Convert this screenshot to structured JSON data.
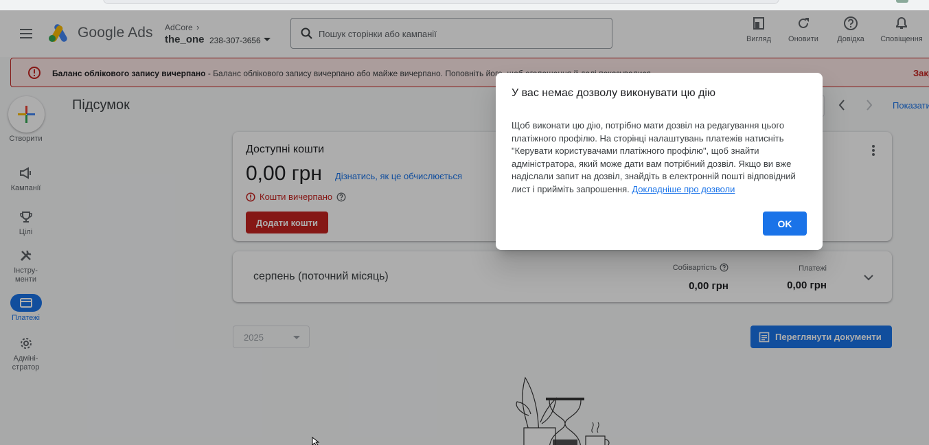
{
  "header": {
    "brand": "Google Ads",
    "account_parent": "AdCore",
    "account_name": "the_one",
    "account_id": "238-307-3656",
    "search_placeholder": "Пошук сторінки або кампанії",
    "tools": [
      {
        "label": "Вигляд",
        "icon": "appearance-icon"
      },
      {
        "label": "Оновити",
        "icon": "refresh-icon"
      },
      {
        "label": "Довідка",
        "icon": "help-icon"
      },
      {
        "label": "Сповіщення",
        "icon": "bell-icon"
      }
    ]
  },
  "alert": {
    "title": "Баланс облікового запису вичерпано",
    "text": " - Баланс облікового запису вичерпано або майже вичерпано. Поповніть його, щоб оголошення й далі показувалися.",
    "close": "Закр"
  },
  "nav": {
    "create": "Створити",
    "items": [
      {
        "label": "Кампанії",
        "icon": "megaphone-icon"
      },
      {
        "label": "Цілі",
        "icon": "trophy-icon"
      },
      {
        "label": "Інстру-\nменти",
        "icon": "tools-icon"
      },
      {
        "label": "Платежі",
        "icon": "card-icon"
      },
      {
        "label": "Адміні-\nстратор",
        "icon": "gear-icon"
      }
    ]
  },
  "main": {
    "title": "Підсумок",
    "show_link": "Показати",
    "funds": {
      "title": "Доступні кошти",
      "amount": "0,00 грн",
      "link": "Дізнатись, як це обчислюється",
      "status": "Кошти вичерпано",
      "button": "Додати кошти"
    },
    "month": {
      "title": "серпень (поточний місяць)",
      "cost_label": "Собівартість",
      "cost_value": "0,00 грн",
      "payments_label": "Платежі",
      "payments_value": "0,00 грн"
    },
    "year": "2025",
    "docs_button": "Переглянути документи"
  },
  "dialog": {
    "title": "У вас немає дозволу виконувати цю дію",
    "body": "Щоб виконати цю дію, потрібно мати дозвіл на редагування цього платіжного профілю. На сторінці налаштувань платежів натисніть \"Керувати користувачами платіжного профілю\", щоб знайти адміністратора, який може дати вам потрібний дозвіл. Якщо ви вже надіслали запит на дозвіл, знайдіть в електронній пошті відповідний лист і прийміть запрошення. ",
    "link": "Докладніше про дозволи",
    "ok": "OK"
  },
  "colors": {
    "accent": "#1a73e8",
    "error": "#c5221f",
    "alert_bg": "#fce8e6"
  }
}
